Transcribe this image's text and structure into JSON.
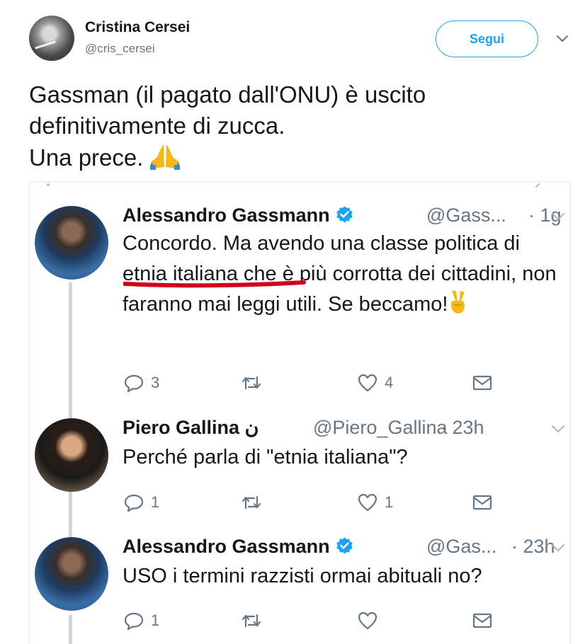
{
  "tweet": {
    "author_name": "Cristina Cersei",
    "author_handle": "@cris_cersei",
    "follow_label": "Segui",
    "text_lines": [
      "Gassman (il pagato dall'ONU) è uscito",
      "definitivamente di zucca.",
      "Una prece."
    ],
    "emoji": "pray-emoji"
  },
  "embedded": {
    "replies": [
      {
        "name": "Alessandro Gassmann",
        "verified": true,
        "handle": "@Gass...",
        "time": "· 1g",
        "text": "Concordo. Ma avendo una classe politica di etnia italiana che è più corrotta dei cittadini, non faranno mai leggi utili. Se beccamo!",
        "emoji": "victory-hand-emoji",
        "reply_count": "3",
        "retweet_count": "",
        "like_count": "4"
      },
      {
        "name": "Piero Gallina",
        "name_suffix": "ن",
        "verified": false,
        "handle": "@Piero_Gallina",
        "time": "· 23h",
        "text": "Perché parla di \"etnia italiana\"?",
        "reply_count": "1",
        "retweet_count": "",
        "like_count": "1"
      },
      {
        "name": "Alessandro Gassmann",
        "verified": true,
        "handle": "@Gas...",
        "time": "· 23h",
        "text": "USO i termini razzisti ormai abituali no?",
        "reply_count": "1",
        "retweet_count": "",
        "like_count": ""
      }
    ]
  },
  "colors": {
    "twitter_blue": "#1da1f2",
    "muted_gray": "#657786",
    "text": "#14171a",
    "highlight_red": "#d0021b"
  }
}
